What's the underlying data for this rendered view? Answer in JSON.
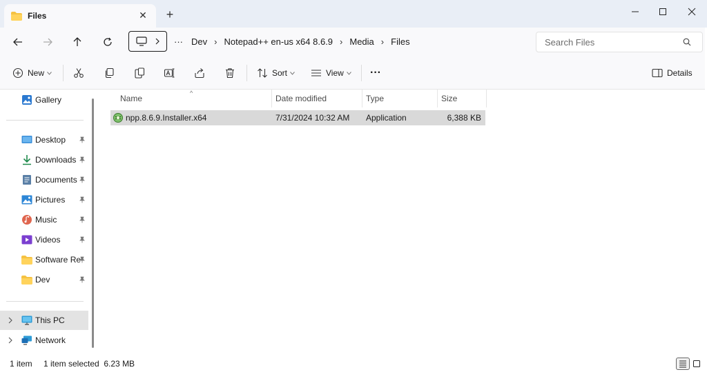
{
  "window": {
    "tab_title": "Files",
    "tab_close_glyph": "✕",
    "new_tab_glyph": "+",
    "min_glyph": "—",
    "max_glyph": "☐",
    "close_glyph": "✕"
  },
  "address": {
    "more_glyph": "···",
    "sep_glyph": "›",
    "crumbs": [
      "Dev",
      "Notepad++ en-us x64 8.6.9",
      "Media",
      "Files"
    ],
    "search_placeholder": "Search Files"
  },
  "toolbar": {
    "new_label": "New",
    "sort_label": "Sort",
    "view_label": "View",
    "more_glyph": "···",
    "details_label": "Details"
  },
  "sidebar": {
    "gallery": "Gallery",
    "quick_access": [
      {
        "label": "Desktop",
        "icon": "desktop-icon"
      },
      {
        "label": "Downloads",
        "icon": "downloads-icon"
      },
      {
        "label": "Documents",
        "icon": "documents-icon"
      },
      {
        "label": "Pictures",
        "icon": "pictures-icon"
      },
      {
        "label": "Music",
        "icon": "music-icon"
      },
      {
        "label": "Videos",
        "icon": "videos-icon"
      },
      {
        "label": "Software Rep",
        "icon": "folder-icon"
      },
      {
        "label": "Dev",
        "icon": "folder-icon"
      }
    ],
    "this_pc": "This PC",
    "network": "Network"
  },
  "columns": {
    "name": "Name",
    "date": "Date modified",
    "type": "Type",
    "size": "Size",
    "sort_glyph": "^"
  },
  "files": [
    {
      "name": "npp.8.6.9.Installer.x64",
      "date": "7/31/2024 10:32 AM",
      "type": "Application",
      "size": "6,388 KB"
    }
  ],
  "status": {
    "item_count": "1 item",
    "selection": "1 item selected  6.23 MB"
  },
  "colors": {
    "accent": "#0067c0",
    "folder": "#f5c242",
    "selection": "#d9d9d9"
  }
}
